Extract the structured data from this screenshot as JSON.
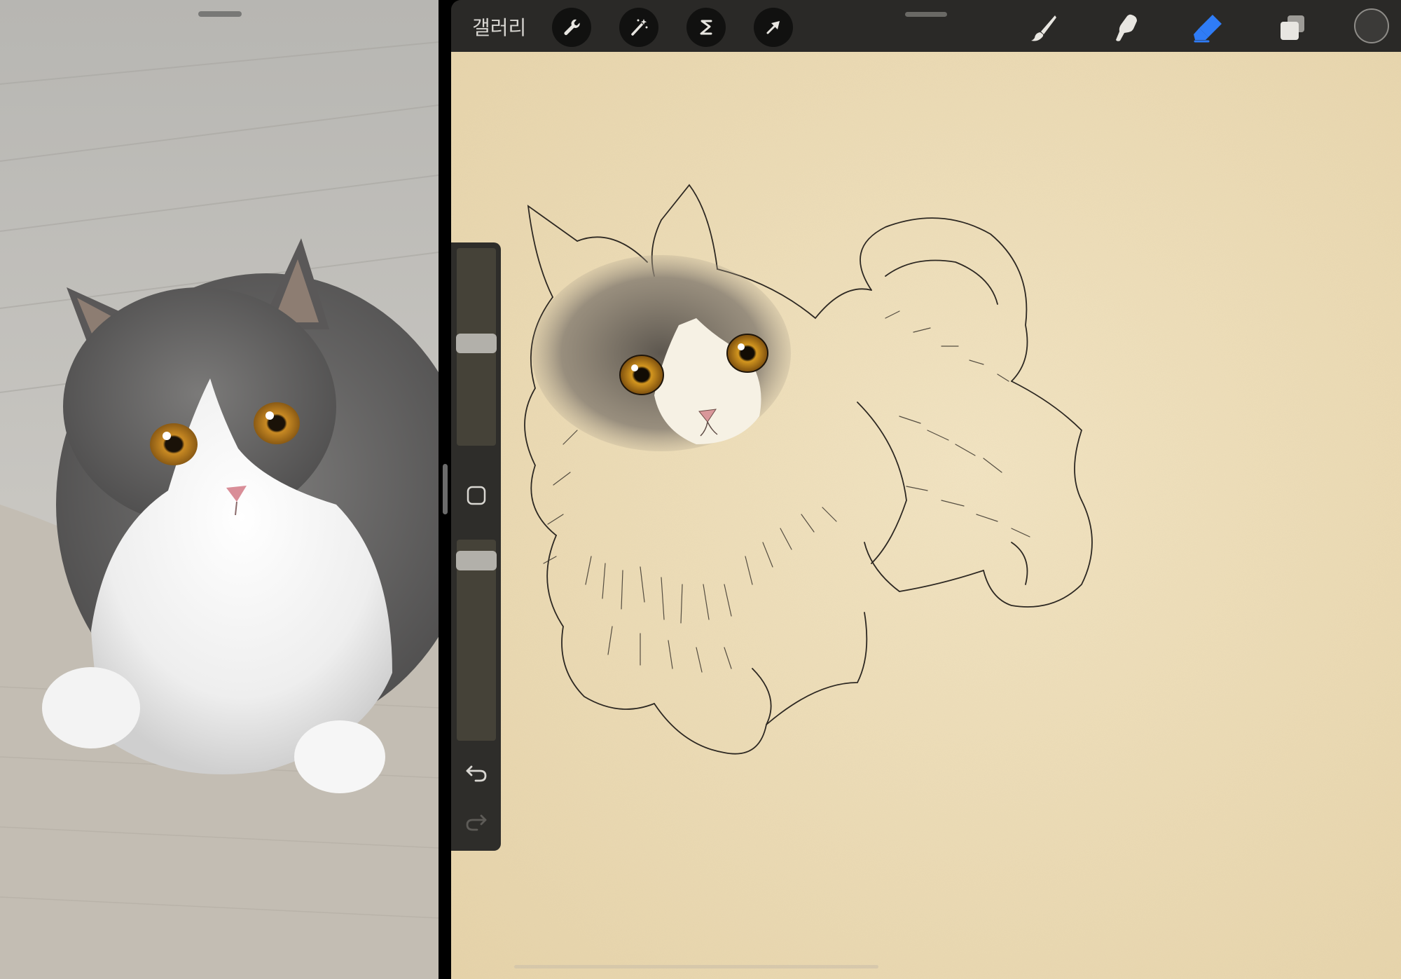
{
  "toolbar": {
    "gallery_label": "갤러리",
    "left_tools": [
      "wrench-icon",
      "magic-wand-icon",
      "selection-s-icon",
      "transform-arrow-icon"
    ],
    "right_tools": [
      "brush-icon",
      "smudge-icon",
      "eraser-icon",
      "layers-icon"
    ],
    "active_tool": "eraser-icon",
    "active_color": "#2f7cf6",
    "current_color": "#3b3a38"
  },
  "sidebar": {
    "brush_size_level": 0.52,
    "opacity_level": 0.06,
    "buttons": [
      "modify-square-icon",
      "undo-icon",
      "redo-icon"
    ]
  },
  "canvas": {
    "paper_color": "#efe0bd"
  }
}
